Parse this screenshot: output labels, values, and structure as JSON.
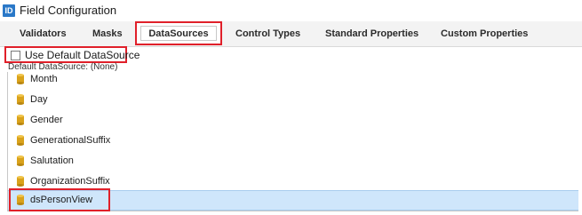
{
  "window": {
    "app_icon_text": "ID",
    "title": "Field Configuration"
  },
  "tabs": [
    {
      "label": "Validators"
    },
    {
      "label": "Masks"
    },
    {
      "label": "DataSources",
      "active": true
    },
    {
      "label": "Control Types"
    },
    {
      "label": "Standard Properties"
    },
    {
      "label": "Custom Properties"
    }
  ],
  "default_datasource": {
    "checkbox_label": "Use Default DataSource",
    "checked": false,
    "status_text": "Default DataSource: (None)"
  },
  "tree": {
    "items": [
      {
        "label": "Month",
        "icon": "database-icon"
      },
      {
        "label": "Day",
        "icon": "database-icon"
      },
      {
        "label": "Gender",
        "icon": "database-icon"
      },
      {
        "label": "GenerationalSuffix",
        "icon": "database-icon"
      },
      {
        "label": "Salutation",
        "icon": "database-icon"
      },
      {
        "label": "OrganizationSuffix",
        "icon": "database-icon"
      },
      {
        "label": "dsPersonView",
        "icon": "database-icon",
        "selected": true
      }
    ]
  },
  "colors": {
    "highlight_frame": "#e0202a",
    "selection": "#cfe6fb",
    "db_icon": "#d9a21b"
  }
}
